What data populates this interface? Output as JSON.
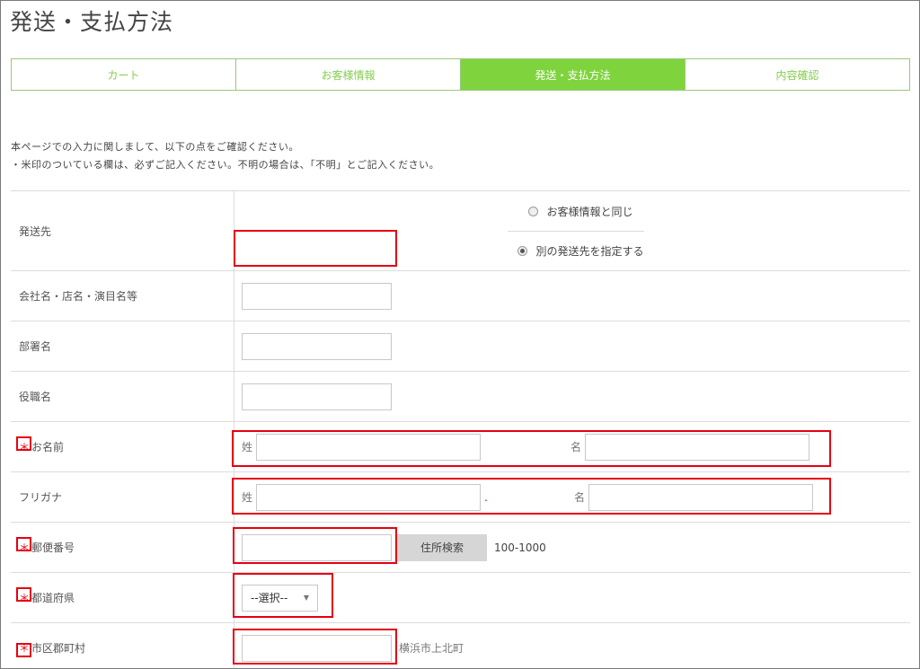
{
  "page": {
    "title": "発送・支払方法"
  },
  "steps": [
    {
      "label": "カート"
    },
    {
      "label": "お客様情報"
    },
    {
      "label": "発送・支払方法"
    },
    {
      "label": "内容確認"
    }
  ],
  "notice": {
    "line1": "本ページでの入力に関しまして、以下の点をご確認ください。",
    "line2": "・米印のついている欄は、必ずご記入ください。不明の場合は、「不明」とご記入ください。"
  },
  "form": {
    "shipping": {
      "label": "発送先",
      "option_same": "お客様情報と同じ",
      "option_other": "別の発送先を指定する"
    },
    "company": {
      "label": "会社名・店名・演目名等"
    },
    "department": {
      "label": "部署名"
    },
    "position": {
      "label": "役職名"
    },
    "name": {
      "label": "お名前",
      "required_mark": "＊",
      "last_prefix": "姓",
      "first_prefix": "名"
    },
    "kana": {
      "label": "フリガナ",
      "last_prefix": "姓",
      "first_prefix": "名",
      "separator": "."
    },
    "zip": {
      "label": "郵便番号",
      "required_mark": "＊",
      "button": "住所検索",
      "example": "100-1000"
    },
    "prefecture": {
      "label": "都道府県",
      "required_mark": "＊",
      "selected": "--選択--"
    },
    "city": {
      "label": "市区郡町村",
      "required_mark": "＊",
      "example": "横浜市上北町"
    }
  },
  "colors": {
    "accent": "#7fd43d",
    "required": "#e60012",
    "annotation": "#e60012"
  }
}
